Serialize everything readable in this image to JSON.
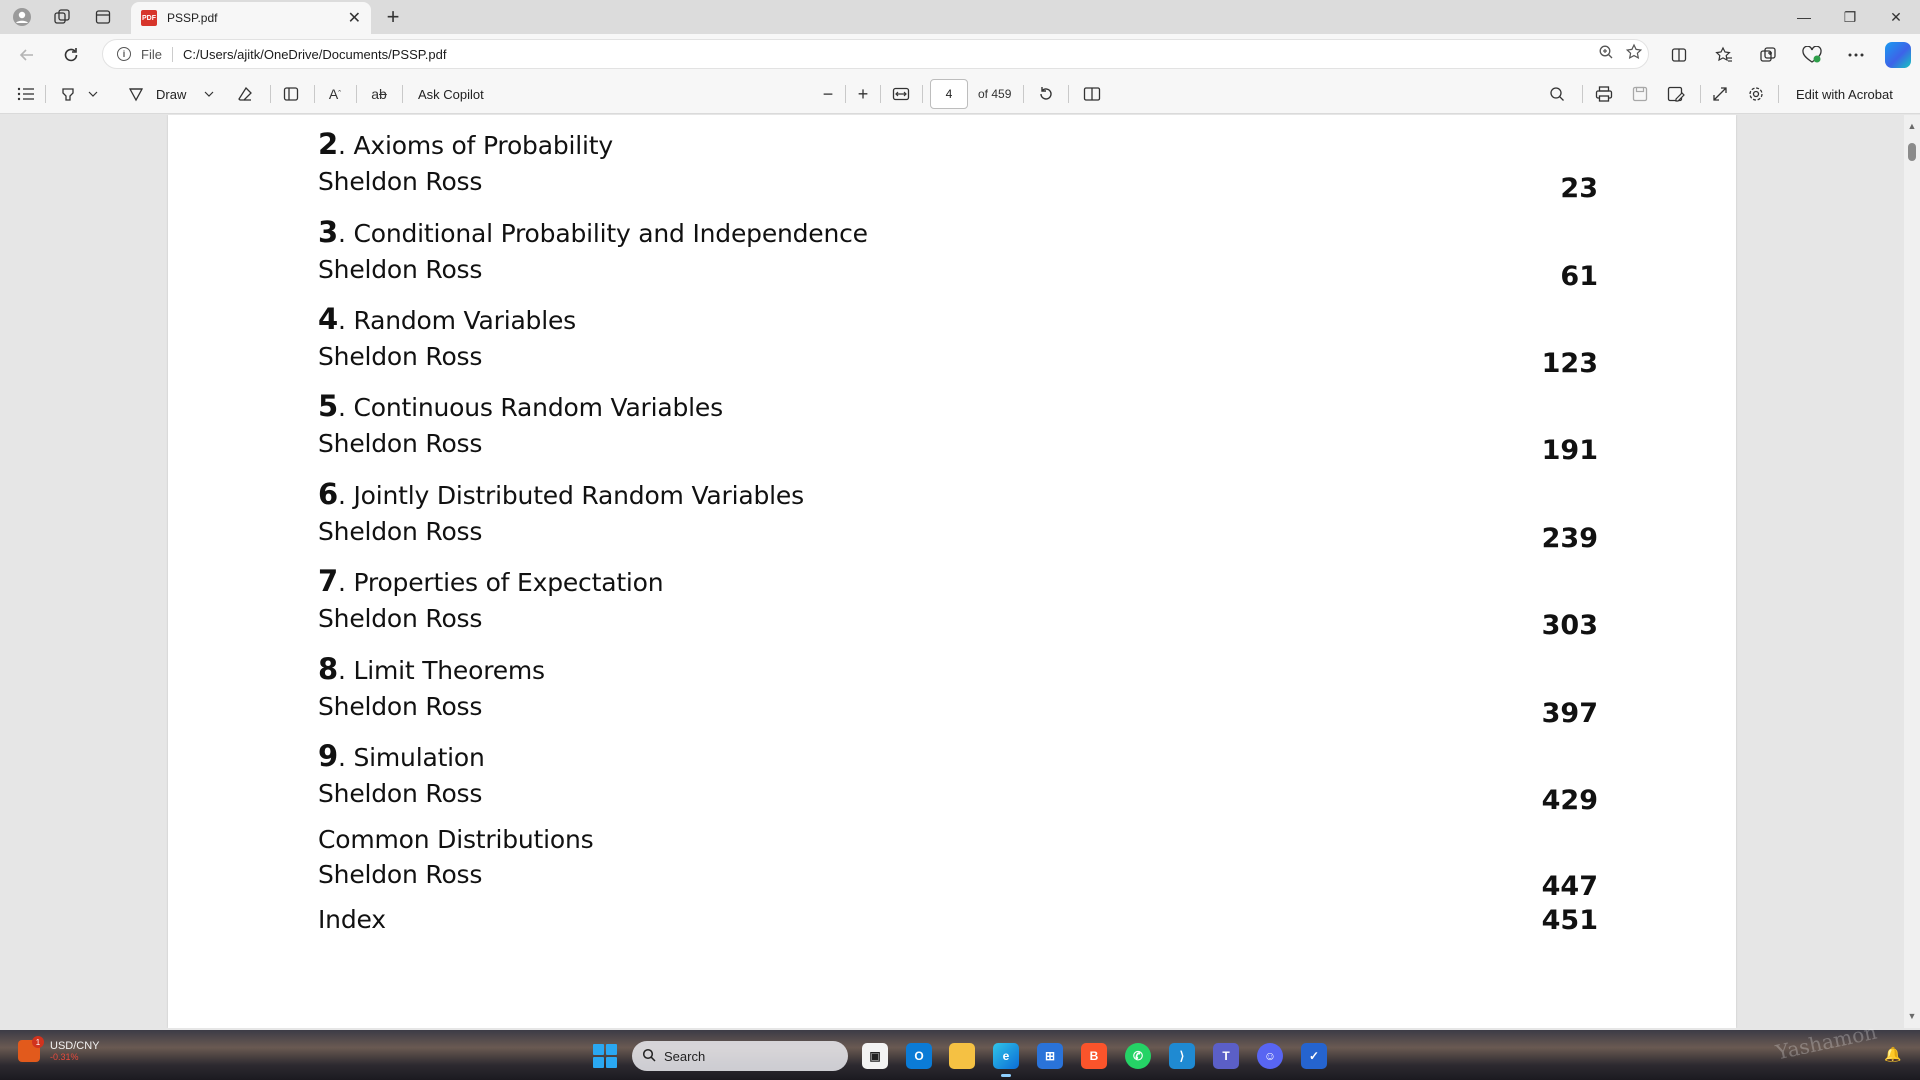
{
  "browser": {
    "tab": {
      "title": "PSSP.pdf",
      "icon": "pdf-icon",
      "close": "✕"
    },
    "new_tab": "+",
    "window_controls": {
      "minimize": "—",
      "restore": "❐",
      "close": "✕"
    },
    "address": {
      "scheme": "File",
      "url": "C:/Users/ajitk/OneDrive/Documents/PSSP.pdf"
    }
  },
  "pdf_toolbar": {
    "draw_label": "Draw",
    "ask_copilot_label": "Ask Copilot",
    "zoom_out": "−",
    "zoom_in": "+",
    "page_current": "4",
    "page_total_label": "of 459",
    "edit_acrobat_label": "Edit with Acrobat"
  },
  "document": {
    "entries": [
      {
        "num": "2",
        "title": "Axioms of Probability",
        "author": "Sheldon Ross",
        "page": "23"
      },
      {
        "num": "3",
        "title": "Conditional Probability and Independence",
        "author": "Sheldon Ross",
        "page": "61"
      },
      {
        "num": "4",
        "title": "Random Variables",
        "author": "Sheldon Ross",
        "page": "123"
      },
      {
        "num": "5",
        "title": "Continuous Random Variables",
        "author": "Sheldon Ross",
        "page": "191"
      },
      {
        "num": "6",
        "title": "Jointly Distributed Random Variables",
        "author": "Sheldon Ross",
        "page": "239"
      },
      {
        "num": "7",
        "title": "Properties of Expectation",
        "author": "Sheldon Ross",
        "page": "303"
      },
      {
        "num": "8",
        "title": "Limit Theorems",
        "author": "Sheldon Ross",
        "page": "397"
      },
      {
        "num": "9",
        "title": "Simulation",
        "author": "Sheldon Ross",
        "page": "429"
      },
      {
        "num": "",
        "title": "Common Distributions",
        "author": "Sheldon Ross",
        "page": "447"
      },
      {
        "num": "",
        "title": "Index",
        "author": "",
        "page": "451"
      }
    ]
  },
  "taskbar": {
    "widget": {
      "name": "USD/CNY",
      "value": "-0.31%",
      "badge": "1"
    },
    "search_placeholder": "Search",
    "watermark": "Yashamon"
  },
  "colors": {
    "page_bg": "#ffffff",
    "viewer_bg": "#e6e6e6",
    "accent": "#0a6cd6"
  }
}
